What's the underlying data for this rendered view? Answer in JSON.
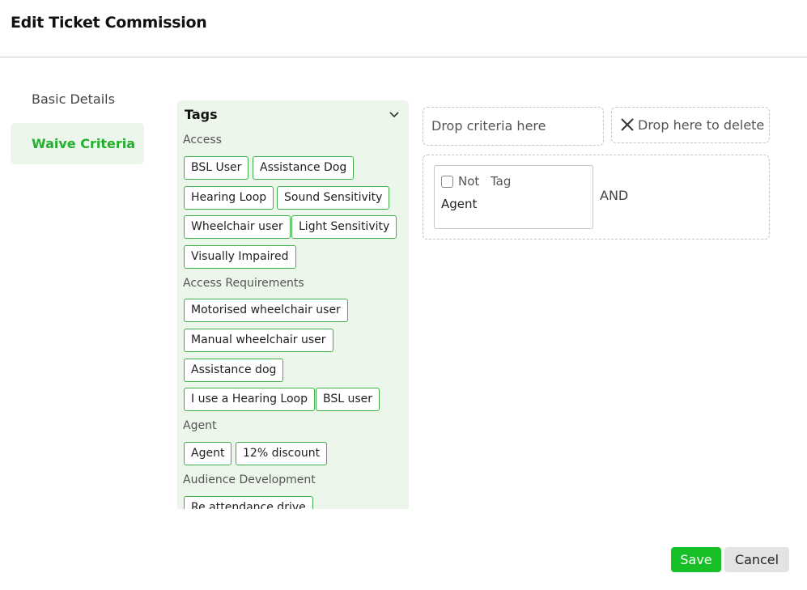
{
  "dialog": {
    "title": "Edit Ticket Commission"
  },
  "nav": {
    "basic_details": "Basic Details",
    "waive_criteria": "Waive Criteria"
  },
  "tags_panel": {
    "title": "Tags",
    "groups": [
      {
        "label": "Access",
        "chips": [
          "BSL User",
          "Assistance Dog",
          "Hearing Loop",
          "Sound Sensitivity",
          "Wheelchair user",
          "Light Sensitivity",
          "Visually Impaired"
        ]
      },
      {
        "label": "Access Requirements",
        "chips": [
          "Motorised wheelchair user",
          "Manual wheelchair user",
          "Assistance dog",
          "I use a Hearing Loop",
          "BSL user"
        ]
      },
      {
        "label": "Agent",
        "chips": [
          "Agent",
          "12% discount"
        ]
      },
      {
        "label": "Audience Development",
        "chips": [
          "Re attendance drive"
        ]
      }
    ]
  },
  "drop_zones": {
    "criteria": "Drop criteria here",
    "delete": "Drop here to delete"
  },
  "criteria": {
    "card": {
      "not_label": "Not",
      "not_checked": false,
      "kind": "Tag",
      "value": "Agent"
    },
    "operator": "AND"
  },
  "footer": {
    "save": "Save",
    "cancel": "Cancel"
  },
  "colors": {
    "accent": "#22b02e",
    "panel_bg": "#ecf6ea",
    "save_bg": "#17c026",
    "chip_border": "#3db04a"
  }
}
